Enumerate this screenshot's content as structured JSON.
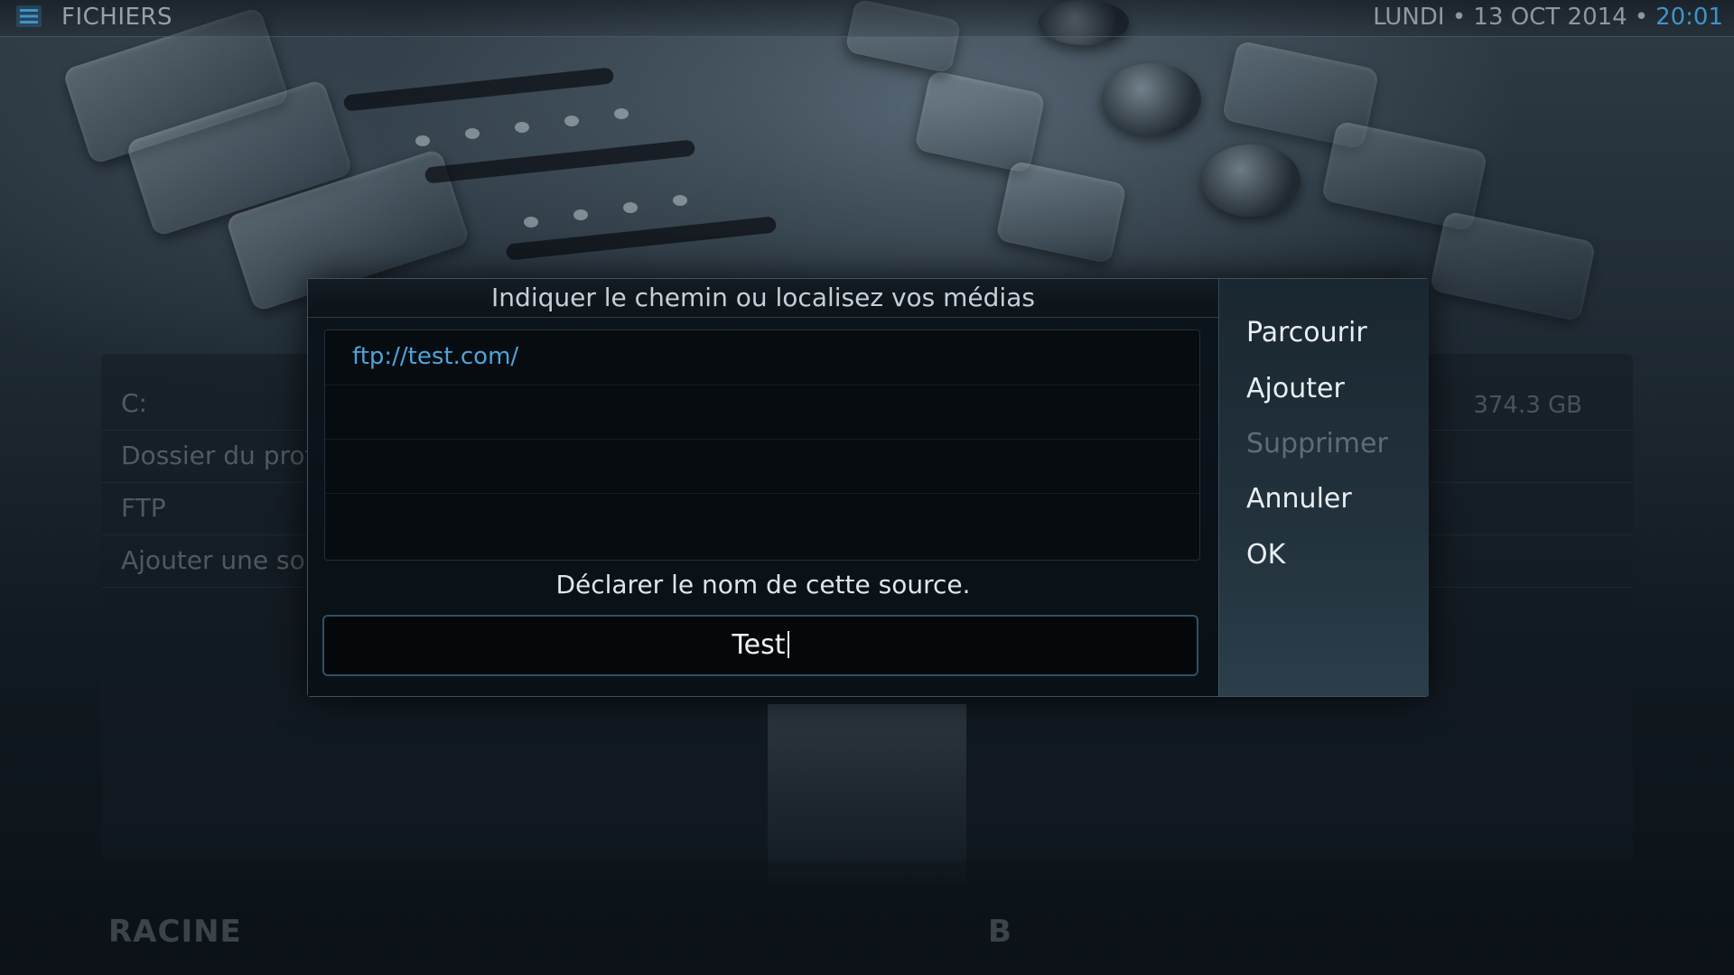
{
  "header": {
    "title": "FICHIERS",
    "date": "LUNDI • 13 OCT 2014",
    "separator": "•",
    "time": "20:01",
    "menu_icon": "hamburger-menu-icon"
  },
  "file_list": {
    "items": [
      {
        "label": "C:"
      },
      {
        "label": "Dossier du profi"
      },
      {
        "label": "FTP"
      },
      {
        "label": "Ajouter une sou"
      }
    ],
    "first_item_size": "374.3 GB"
  },
  "footer": {
    "left": "RACINE",
    "middle": "B"
  },
  "dialog": {
    "title": "Indiquer le chemin ou localisez vos médias",
    "paths": [
      "ftp://test.com/"
    ],
    "name_label": "Déclarer le nom de cette source.",
    "name_value": "Test",
    "buttons": {
      "browse": "Parcourir",
      "add": "Ajouter",
      "remove": "Supprimer",
      "cancel": "Annuler",
      "ok": "OK"
    }
  },
  "colors": {
    "accent": "#4fa3d8",
    "time": "#3f93c8"
  }
}
